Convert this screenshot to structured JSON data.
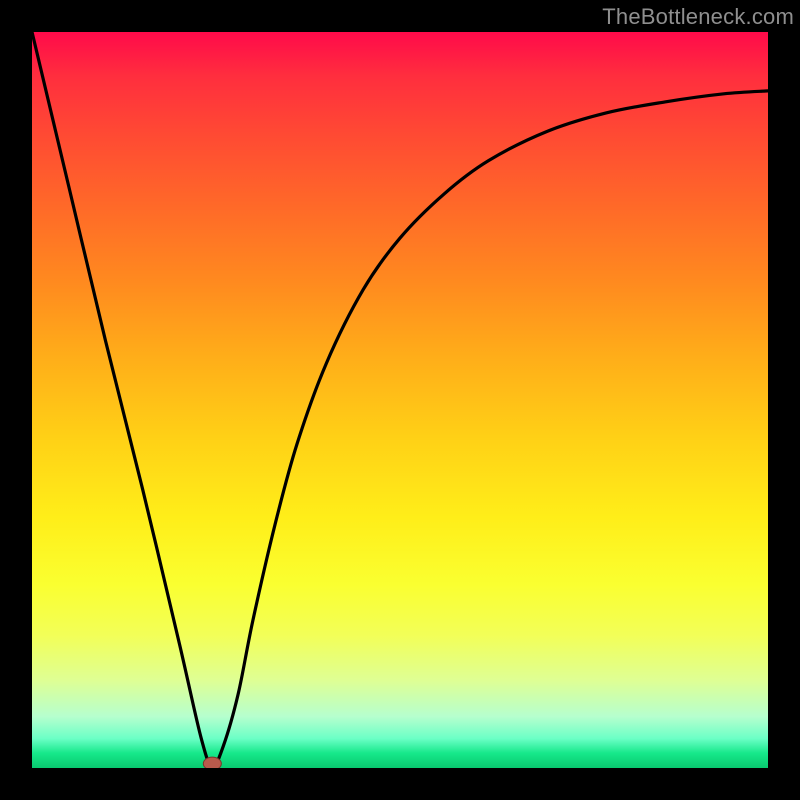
{
  "watermark": "TheBottleneck.com",
  "chart_data": {
    "type": "line",
    "title": "",
    "xlabel": "",
    "ylabel": "",
    "xlim": [
      0,
      100
    ],
    "ylim": [
      0,
      100
    ],
    "series": [
      {
        "name": "bottleneck-curve",
        "x": [
          0,
          5,
          10,
          15,
          20,
          23,
          24.5,
          26,
          28,
          30,
          33,
          36,
          40,
          45,
          50,
          56,
          62,
          70,
          78,
          86,
          94,
          100
        ],
        "y": [
          100,
          79,
          58,
          38,
          17,
          4,
          0.2,
          3,
          10,
          20,
          33,
          44,
          55,
          65,
          72,
          78,
          82.5,
          86.5,
          89,
          90.5,
          91.6,
          92
        ]
      }
    ],
    "marker": {
      "x": 24.5,
      "y": 0.6
    },
    "gradient_stops": [
      {
        "pct": 0,
        "color": "#ff0a4a"
      },
      {
        "pct": 25,
        "color": "#ff7a22"
      },
      {
        "pct": 55,
        "color": "#ffd016"
      },
      {
        "pct": 80,
        "color": "#f5ff42"
      },
      {
        "pct": 100,
        "color": "#09c96f"
      }
    ]
  }
}
